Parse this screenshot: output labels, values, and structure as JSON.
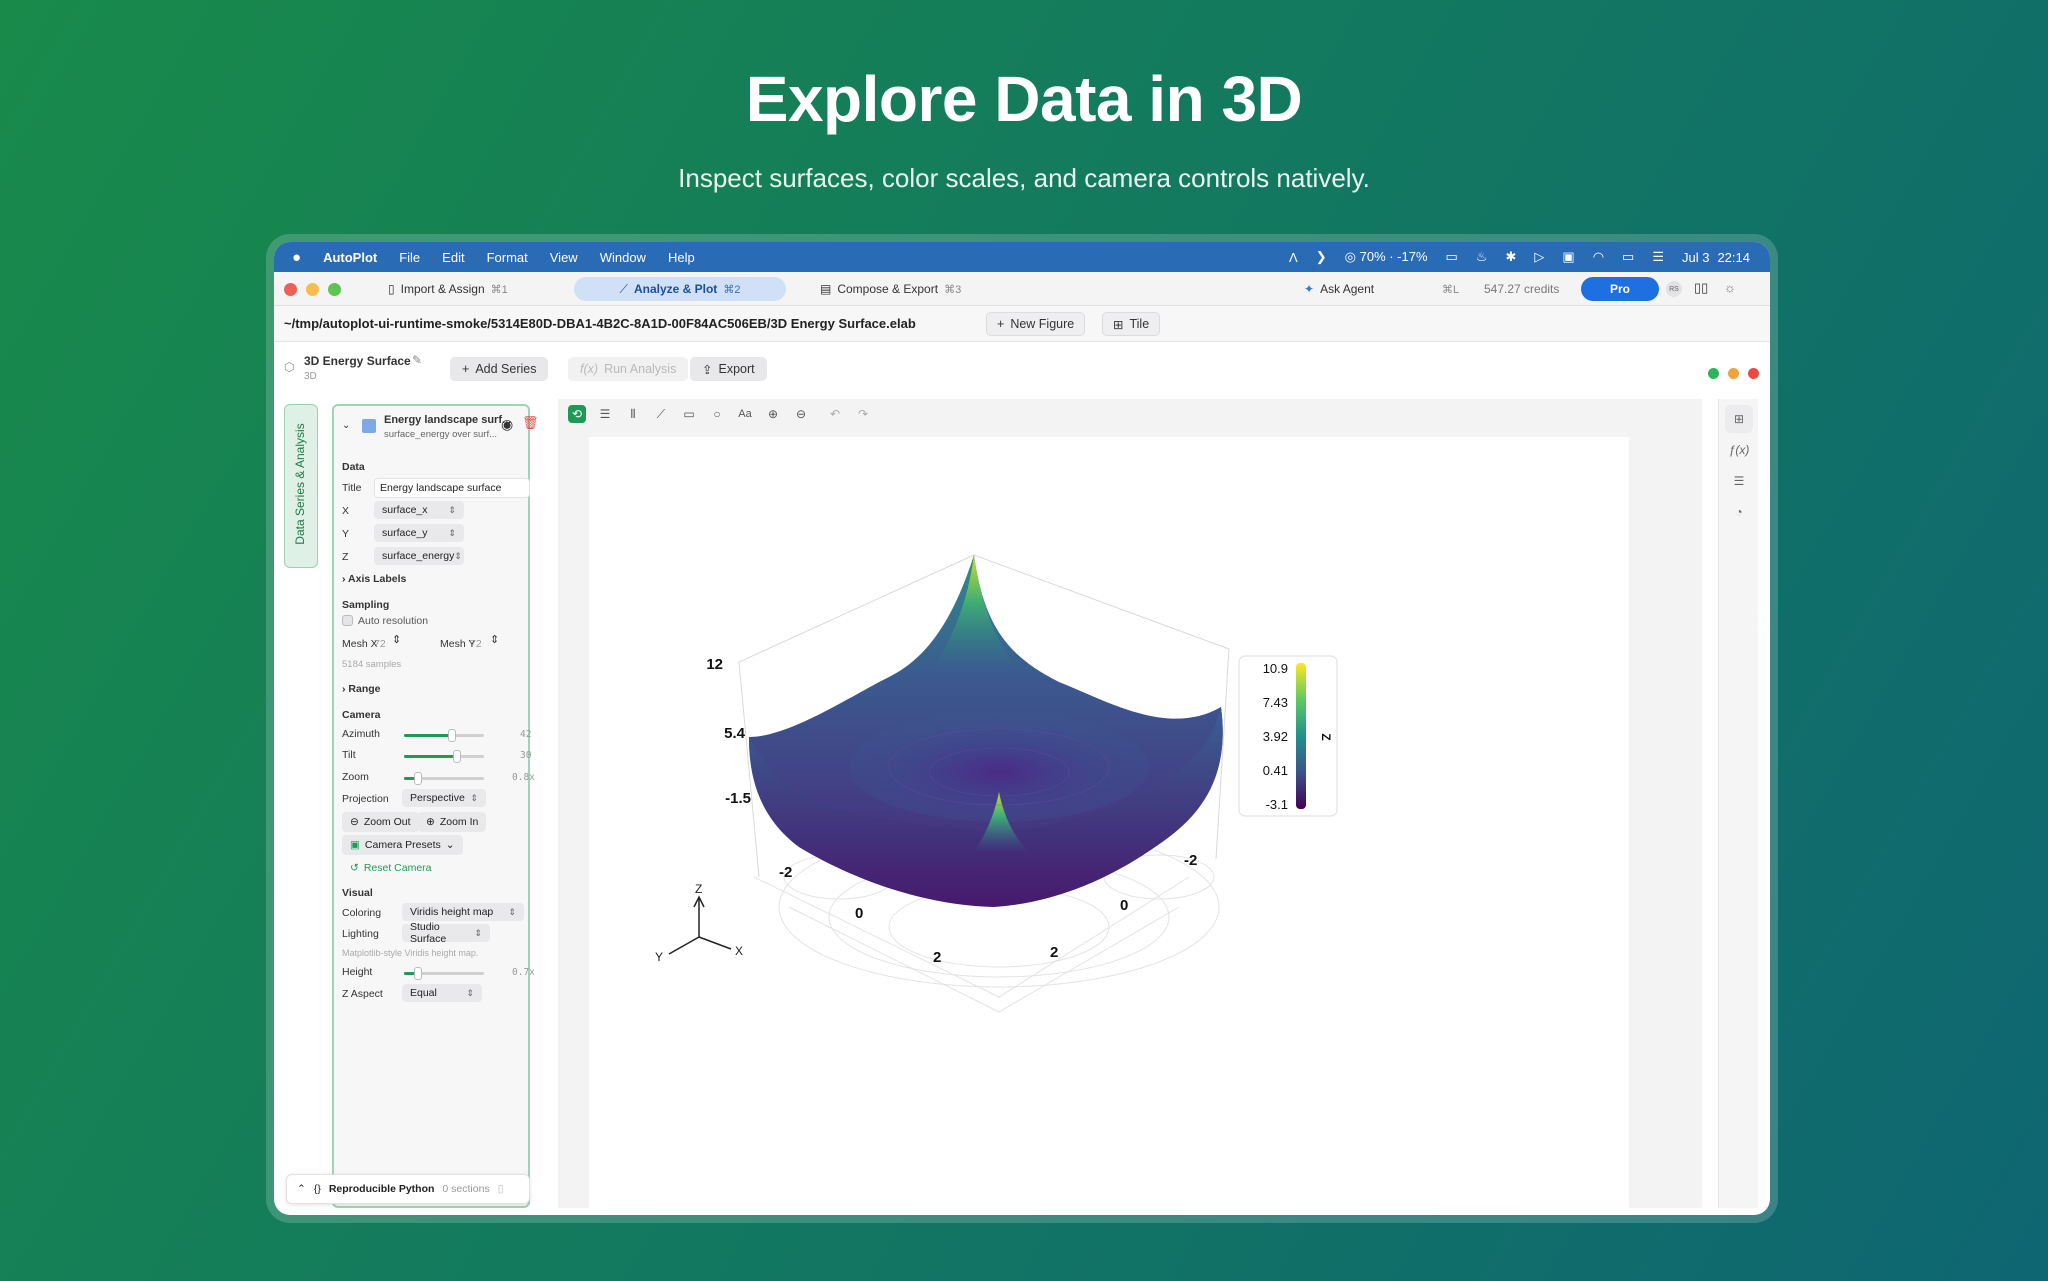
{
  "hero": {
    "title": "Explore Data in 3D",
    "subtitle": "Inspect surfaces, color scales, and camera controls natively."
  },
  "menubar": {
    "app": "AutoPlot",
    "items": [
      "File",
      "Edit",
      "Format",
      "View",
      "Window",
      "Help"
    ],
    "status": {
      "cpu": "70% · -17%",
      "date": "Jul 3",
      "time": "22:14"
    }
  },
  "tabs": [
    {
      "label": "Import & Assign",
      "shortcut": "⌘1"
    },
    {
      "label": "Analyze & Plot",
      "shortcut": "⌘2"
    },
    {
      "label": "Compose & Export",
      "shortcut": "⌘3"
    }
  ],
  "toolbar_right": {
    "ask_agent": "Ask Agent",
    "shortcut": "⌘L",
    "credits": "547.27 credits",
    "pro": "Pro",
    "avatar": "RS"
  },
  "pathbar": {
    "path": "~/tmp/autoplot-ui-runtime-smoke/5314E80D-DBA1-4B2C-8A1D-00F84AC506EB/3D Energy Surface.elab",
    "new_figure": "New Figure",
    "tile": "Tile"
  },
  "doc": {
    "title": "3D Energy Surface",
    "subtitle": "3D",
    "add_series": "Add Series",
    "run_analysis": "Run Analysis",
    "export": "Export"
  },
  "sidebar_tab": "Data Series & Analysis",
  "panel": {
    "series_name": "Energy landscape surf...",
    "series_desc": "surface_energy over surf...",
    "data_label": "Data",
    "title_label": "Title",
    "title_value": "Energy landscape surface",
    "x_label": "X",
    "x_value": "surface_x",
    "y_label": "Y",
    "y_value": "surface_y",
    "z_label": "Z",
    "z_value": "surface_energy",
    "axis_labels": "Axis Labels",
    "sampling": "Sampling",
    "auto_resolution": "Auto resolution",
    "mesh_x_label": "Mesh X",
    "mesh_x": "72",
    "mesh_y_label": "Mesh Y",
    "mesh_y": "72",
    "samples": "5184 samples",
    "range": "Range",
    "camera": "Camera",
    "azimuth_label": "Azimuth",
    "azimuth": "42",
    "azimuth_frac": 0.6,
    "tilt_label": "Tilt",
    "tilt": "30",
    "tilt_frac": 0.66,
    "zoom_label": "Zoom",
    "zoom": "0.8x",
    "zoom_frac": 0.18,
    "projection_label": "Projection",
    "projection": "Perspective",
    "zoom_out": "Zoom Out",
    "zoom_in": "Zoom In",
    "camera_presets": "Camera Presets",
    "reset_camera": "Reset Camera",
    "visual": "Visual",
    "coloring_label": "Coloring",
    "coloring": "Viridis height map",
    "lighting_label": "Lighting",
    "lighting": "Studio Surface",
    "hint": "Matplotlib-style Viridis height map.",
    "height_label": "Height",
    "height": "0.7x",
    "height_frac": 0.18,
    "zaspect_label": "Z Aspect",
    "zaspect": "Equal"
  },
  "python_bar": {
    "label": "Reproducible Python",
    "sections": "0 sections"
  },
  "chart_data": {
    "type": "surface3d",
    "z_ticks": [
      "12",
      "5.4",
      "-1.5"
    ],
    "x_ticks": [
      "-2",
      "0",
      "2"
    ],
    "y_ticks": [
      "-2",
      "0",
      "2"
    ],
    "colorbar": {
      "label": "Z",
      "ticks": [
        "10.9",
        "7.43",
        "3.92",
        "0.41",
        "-3.1"
      ],
      "min": -3.1,
      "max": 10.9,
      "colormap": "viridis"
    },
    "triad": {
      "z": "Z",
      "y": "Y",
      "x": "X"
    }
  }
}
